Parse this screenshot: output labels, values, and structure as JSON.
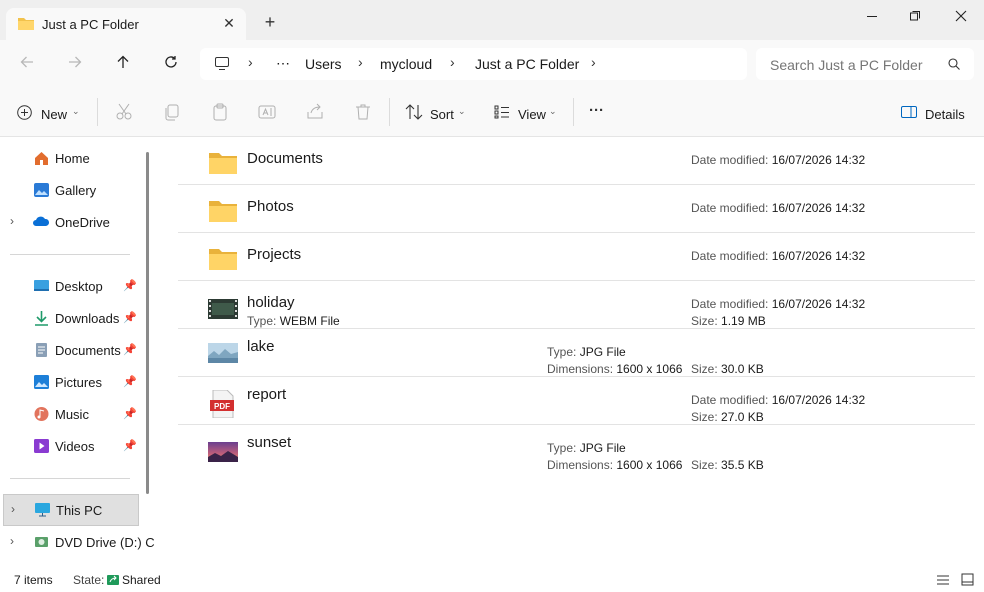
{
  "window": {
    "tab_title": "Just a PC Folder",
    "tab_close": "✕",
    "new_tab": "+"
  },
  "address": {
    "crumbs": [
      "Users",
      "mycloud",
      "Just a PC Folder"
    ],
    "ellipsis": "⋯",
    "search_placeholder": "Search Just a PC Folder"
  },
  "toolbar": {
    "new_label": "New",
    "sort_label": "Sort",
    "view_label": "View",
    "more_label": "···",
    "details_label": "Details"
  },
  "sidebar": {
    "top": [
      {
        "label": "Home",
        "icon": "home-icon"
      },
      {
        "label": "Gallery",
        "icon": "gallery-icon"
      },
      {
        "label": "OneDrive",
        "icon": "onedrive-icon"
      }
    ],
    "quick": [
      {
        "label": "Desktop",
        "icon": "desktop-icon"
      },
      {
        "label": "Downloads",
        "icon": "downloads-icon"
      },
      {
        "label": "Documents",
        "icon": "documents-icon"
      },
      {
        "label": "Pictures",
        "icon": "pictures-icon"
      },
      {
        "label": "Music",
        "icon": "music-icon"
      },
      {
        "label": "Videos",
        "icon": "videos-icon"
      }
    ],
    "devices": [
      {
        "label": "This PC",
        "icon": "this-pc-icon"
      },
      {
        "label": "DVD Drive (D:) C",
        "icon": "dvd-drive-icon"
      }
    ]
  },
  "files": [
    {
      "name": "Documents",
      "icon": "folder-icon",
      "date_label": "Date modified:",
      "date": "16/07/2026 14:32"
    },
    {
      "name": "Photos",
      "icon": "folder-icon",
      "date_label": "Date modified:",
      "date": "16/07/2026 14:32"
    },
    {
      "name": "Projects",
      "icon": "folder-icon",
      "date_label": "Date modified:",
      "date": "16/07/2026 14:32"
    },
    {
      "name": "holiday",
      "icon": "video-file-icon",
      "type_label": "Type:",
      "type": "WEBM File",
      "date_label": "Date modified:",
      "date": "16/07/2026 14:32",
      "size_label": "Size:",
      "size": "1.19 MB"
    },
    {
      "name": "lake",
      "icon": "image-file-icon",
      "type_label": "Type:",
      "type": "JPG File",
      "dim_label": "Dimensions:",
      "dim": "1600 x 1066",
      "size_label": "Size:",
      "size": "30.0 KB"
    },
    {
      "name": "report",
      "icon": "pdf-file-icon",
      "date_label": "Date modified:",
      "date": "16/07/2026 14:32",
      "size_label": "Size:",
      "size": "27.0 KB"
    },
    {
      "name": "sunset",
      "icon": "image-file-icon",
      "type_label": "Type:",
      "type": "JPG File",
      "dim_label": "Dimensions:",
      "dim": "1600 x 1066",
      "size_label": "Size:",
      "size": "35.5 KB"
    }
  ],
  "pdf_icon_text": "PDF",
  "status": {
    "items": "7 items",
    "state_label": "State:",
    "state": "Shared"
  },
  "colors": {
    "folder": "#f2c24c",
    "accent": "#0067c0"
  }
}
